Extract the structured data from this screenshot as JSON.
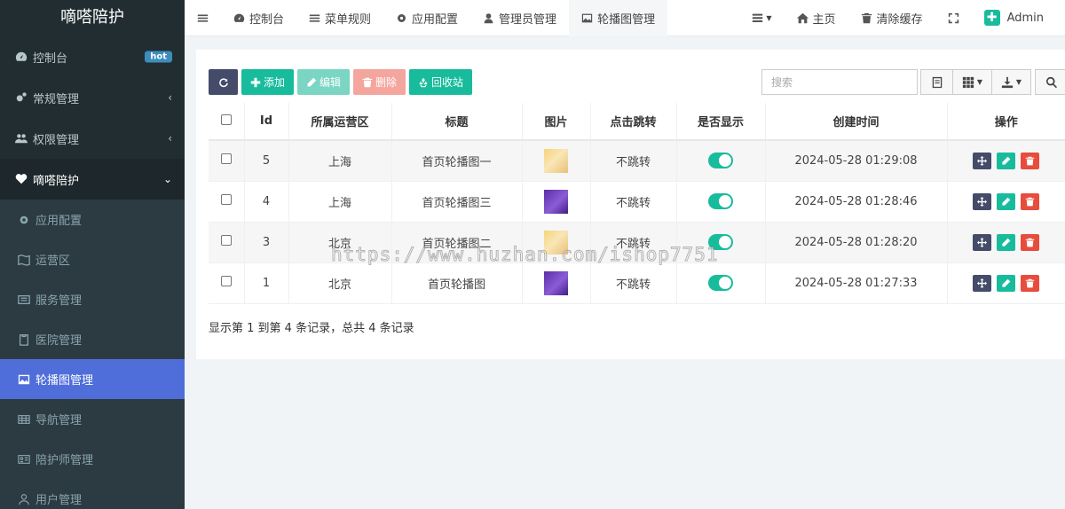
{
  "sidebar": {
    "logo": "嘀嗒陪护",
    "items": [
      {
        "label": "控制台",
        "badge": "hot"
      },
      {
        "label": "常规管理"
      },
      {
        "label": "权限管理"
      },
      {
        "label": "嘀嗒陪护"
      }
    ],
    "sub_items": [
      {
        "label": "应用配置"
      },
      {
        "label": "运营区"
      },
      {
        "label": "服务管理"
      },
      {
        "label": "医院管理"
      },
      {
        "label": "轮播图管理"
      },
      {
        "label": "导航管理"
      },
      {
        "label": "陪护师管理"
      },
      {
        "label": "用户管理"
      }
    ]
  },
  "topbar": {
    "tabs": [
      "控制台",
      "菜单规则",
      "应用配置",
      "管理员管理",
      "轮播图管理"
    ],
    "home": "主页",
    "clear_cache": "清除缓存",
    "user": "Admin"
  },
  "toolbar": {
    "add": "添加",
    "edit": "编辑",
    "delete": "删除",
    "recycle": "回收站",
    "search_placeholder": "搜索"
  },
  "table": {
    "headers": [
      "Id",
      "所属运营区",
      "标题",
      "图片",
      "点击跳转",
      "是否显示",
      "创建时间",
      "操作"
    ],
    "rows": [
      {
        "id": "5",
        "region": "上海",
        "title": "首页轮播图一",
        "jump": "不跳转",
        "time": "2024-05-28 01:29:08"
      },
      {
        "id": "4",
        "region": "上海",
        "title": "首页轮播图三",
        "jump": "不跳转",
        "time": "2024-05-28 01:28:46"
      },
      {
        "id": "3",
        "region": "北京",
        "title": "首页轮播图二",
        "jump": "不跳转",
        "time": "2024-05-28 01:28:20"
      },
      {
        "id": "1",
        "region": "北京",
        "title": "首页轮播图",
        "jump": "不跳转",
        "time": "2024-05-28 01:27:33"
      }
    ]
  },
  "pager_info": "显示第 1 到第 4 条记录，总共 4 条记录",
  "watermark": "https://www.huzhan.com/ishop7751"
}
